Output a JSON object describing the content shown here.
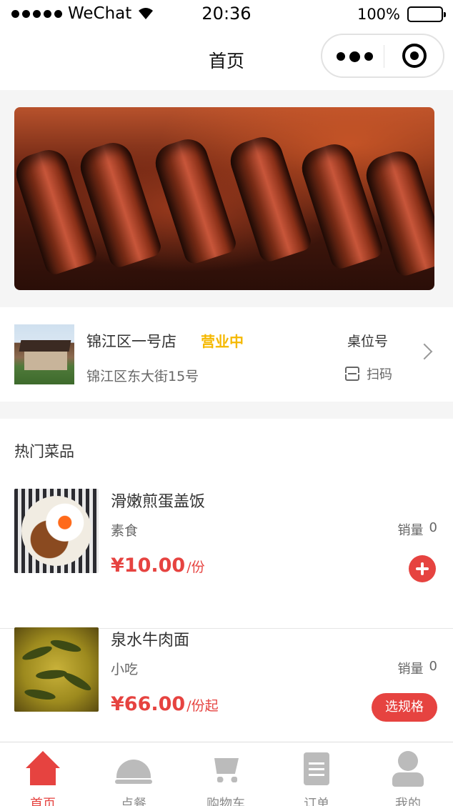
{
  "status_bar": {
    "carrier": "WeChat",
    "time": "20:36",
    "battery": "100%"
  },
  "nav": {
    "title": "首页",
    "more_icon": "more-dots-icon",
    "close_icon": "target-icon"
  },
  "banner": {
    "icon": "steak-banner-image"
  },
  "shop": {
    "name": "锦江区一号店",
    "status": "营业中",
    "address": "锦江区东大街15号",
    "table_label": "桌位号",
    "scan_label": "扫码",
    "status_color": "#f5b800"
  },
  "hot": {
    "title": "热门菜品",
    "dishes": [
      {
        "name": "滑嫩煎蛋盖饭",
        "tag": "素食",
        "sales_label": "销量",
        "sales": "0",
        "price": "¥10.00",
        "unit": "/份",
        "action": "add"
      },
      {
        "name": "泉水牛肉面",
        "tag": "小吃",
        "sales_label": "销量",
        "sales": "0",
        "price": "¥66.00",
        "unit": "/份起",
        "action": "选规格"
      }
    ]
  },
  "tabbar": {
    "items": [
      {
        "label": "首页",
        "icon": "home-icon",
        "active": true
      },
      {
        "label": "点餐",
        "icon": "cloche-icon",
        "active": false
      },
      {
        "label": "购物车",
        "icon": "cart-icon",
        "active": false
      },
      {
        "label": "订单",
        "icon": "order-icon",
        "active": false
      },
      {
        "label": "我的",
        "icon": "profile-icon",
        "active": false
      }
    ]
  },
  "colors": {
    "accent": "#e64340",
    "status": "#f5b800",
    "inactive": "#8a8a8a"
  }
}
